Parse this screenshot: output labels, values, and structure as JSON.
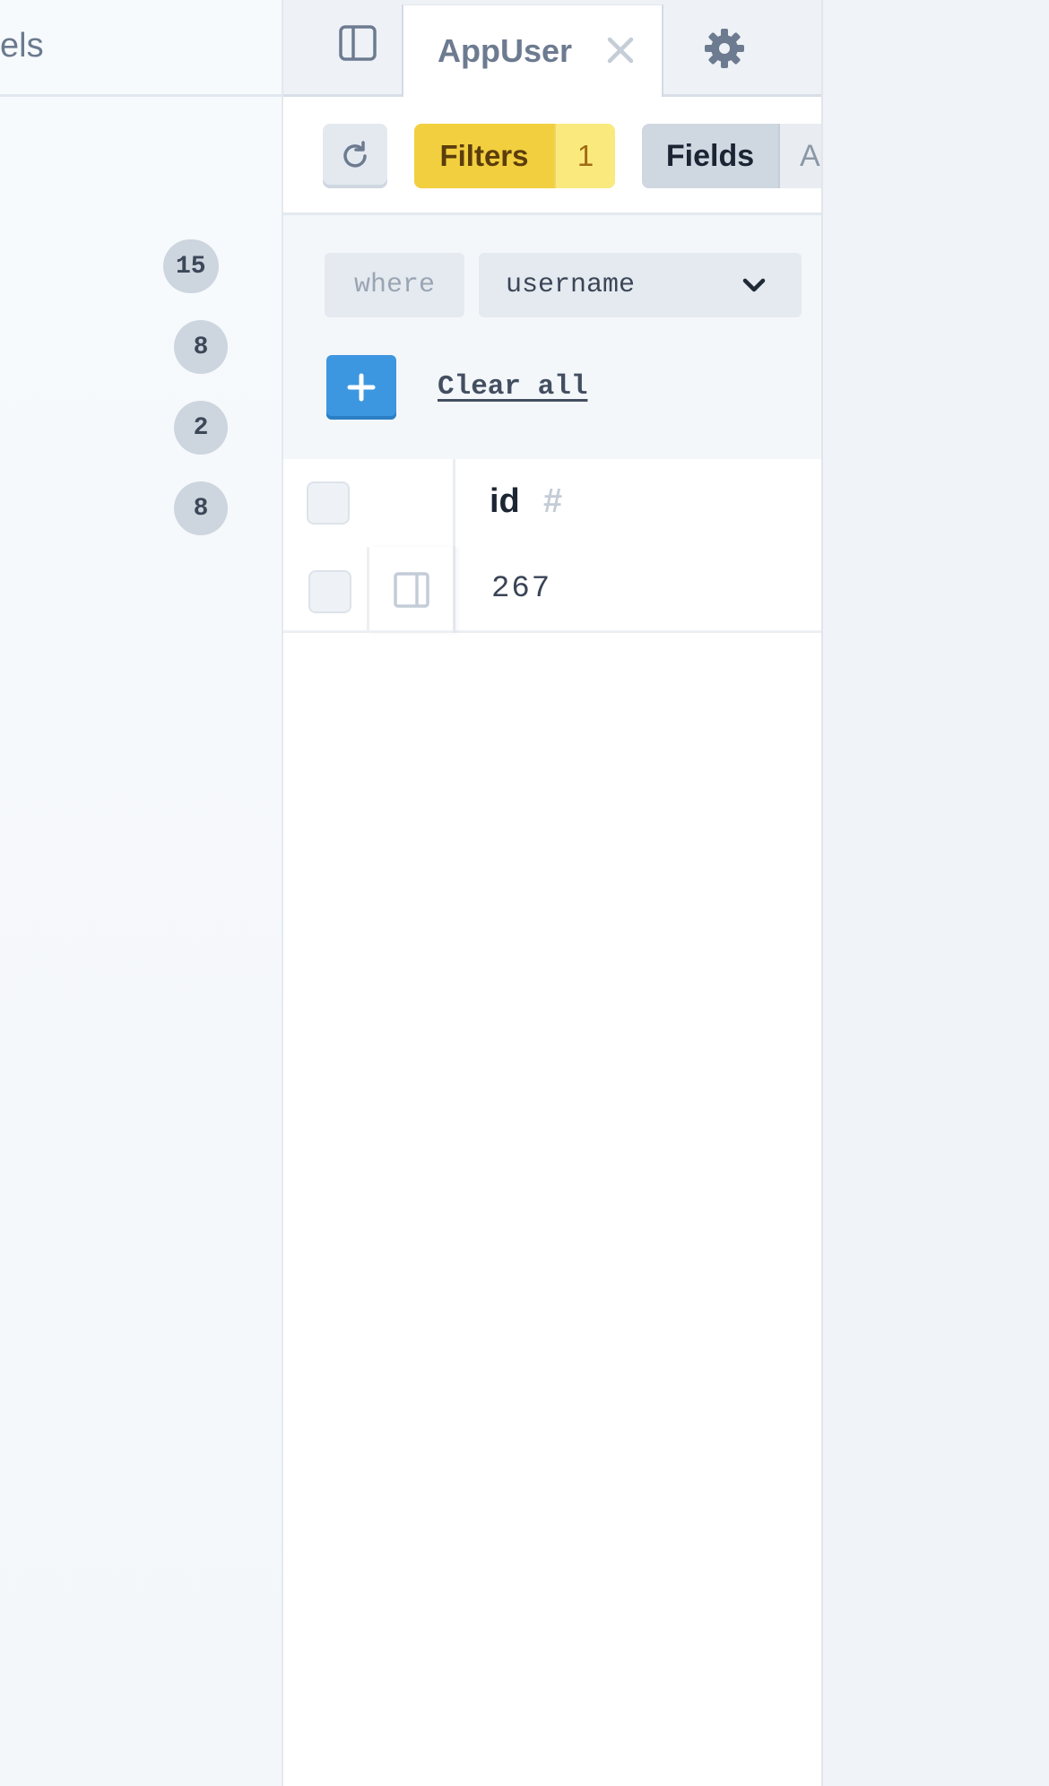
{
  "sidebar": {
    "title": "els",
    "counts": [
      "15",
      "8",
      "2",
      "8"
    ]
  },
  "tab": {
    "label": "AppUser"
  },
  "icons": {
    "panel_toggle": "sidebar-toggle-icon",
    "tab_close": "close-icon",
    "settings": "gear-icon",
    "refresh": "refresh-icon",
    "add": "plus-icon",
    "select_chevron": "chevron-down-icon",
    "row_expand": "panel-right-icon"
  },
  "toolbar": {
    "filters_label": "Filters",
    "filters_count": "1",
    "fields_label": "Fields",
    "fields_suffix": "A"
  },
  "filter": {
    "where_label": "where",
    "field_value": "username",
    "clear_all_label": "Clear all"
  },
  "grid": {
    "columns": [
      {
        "name": "id",
        "type_glyph": "#"
      }
    ],
    "rows": [
      {
        "id": "267"
      }
    ]
  },
  "colors": {
    "filters_bg": "#f2cf3e",
    "filters_count_bg": "#faea7e",
    "add_button": "#3d97e0",
    "badge_bg": "#cdd5df"
  }
}
